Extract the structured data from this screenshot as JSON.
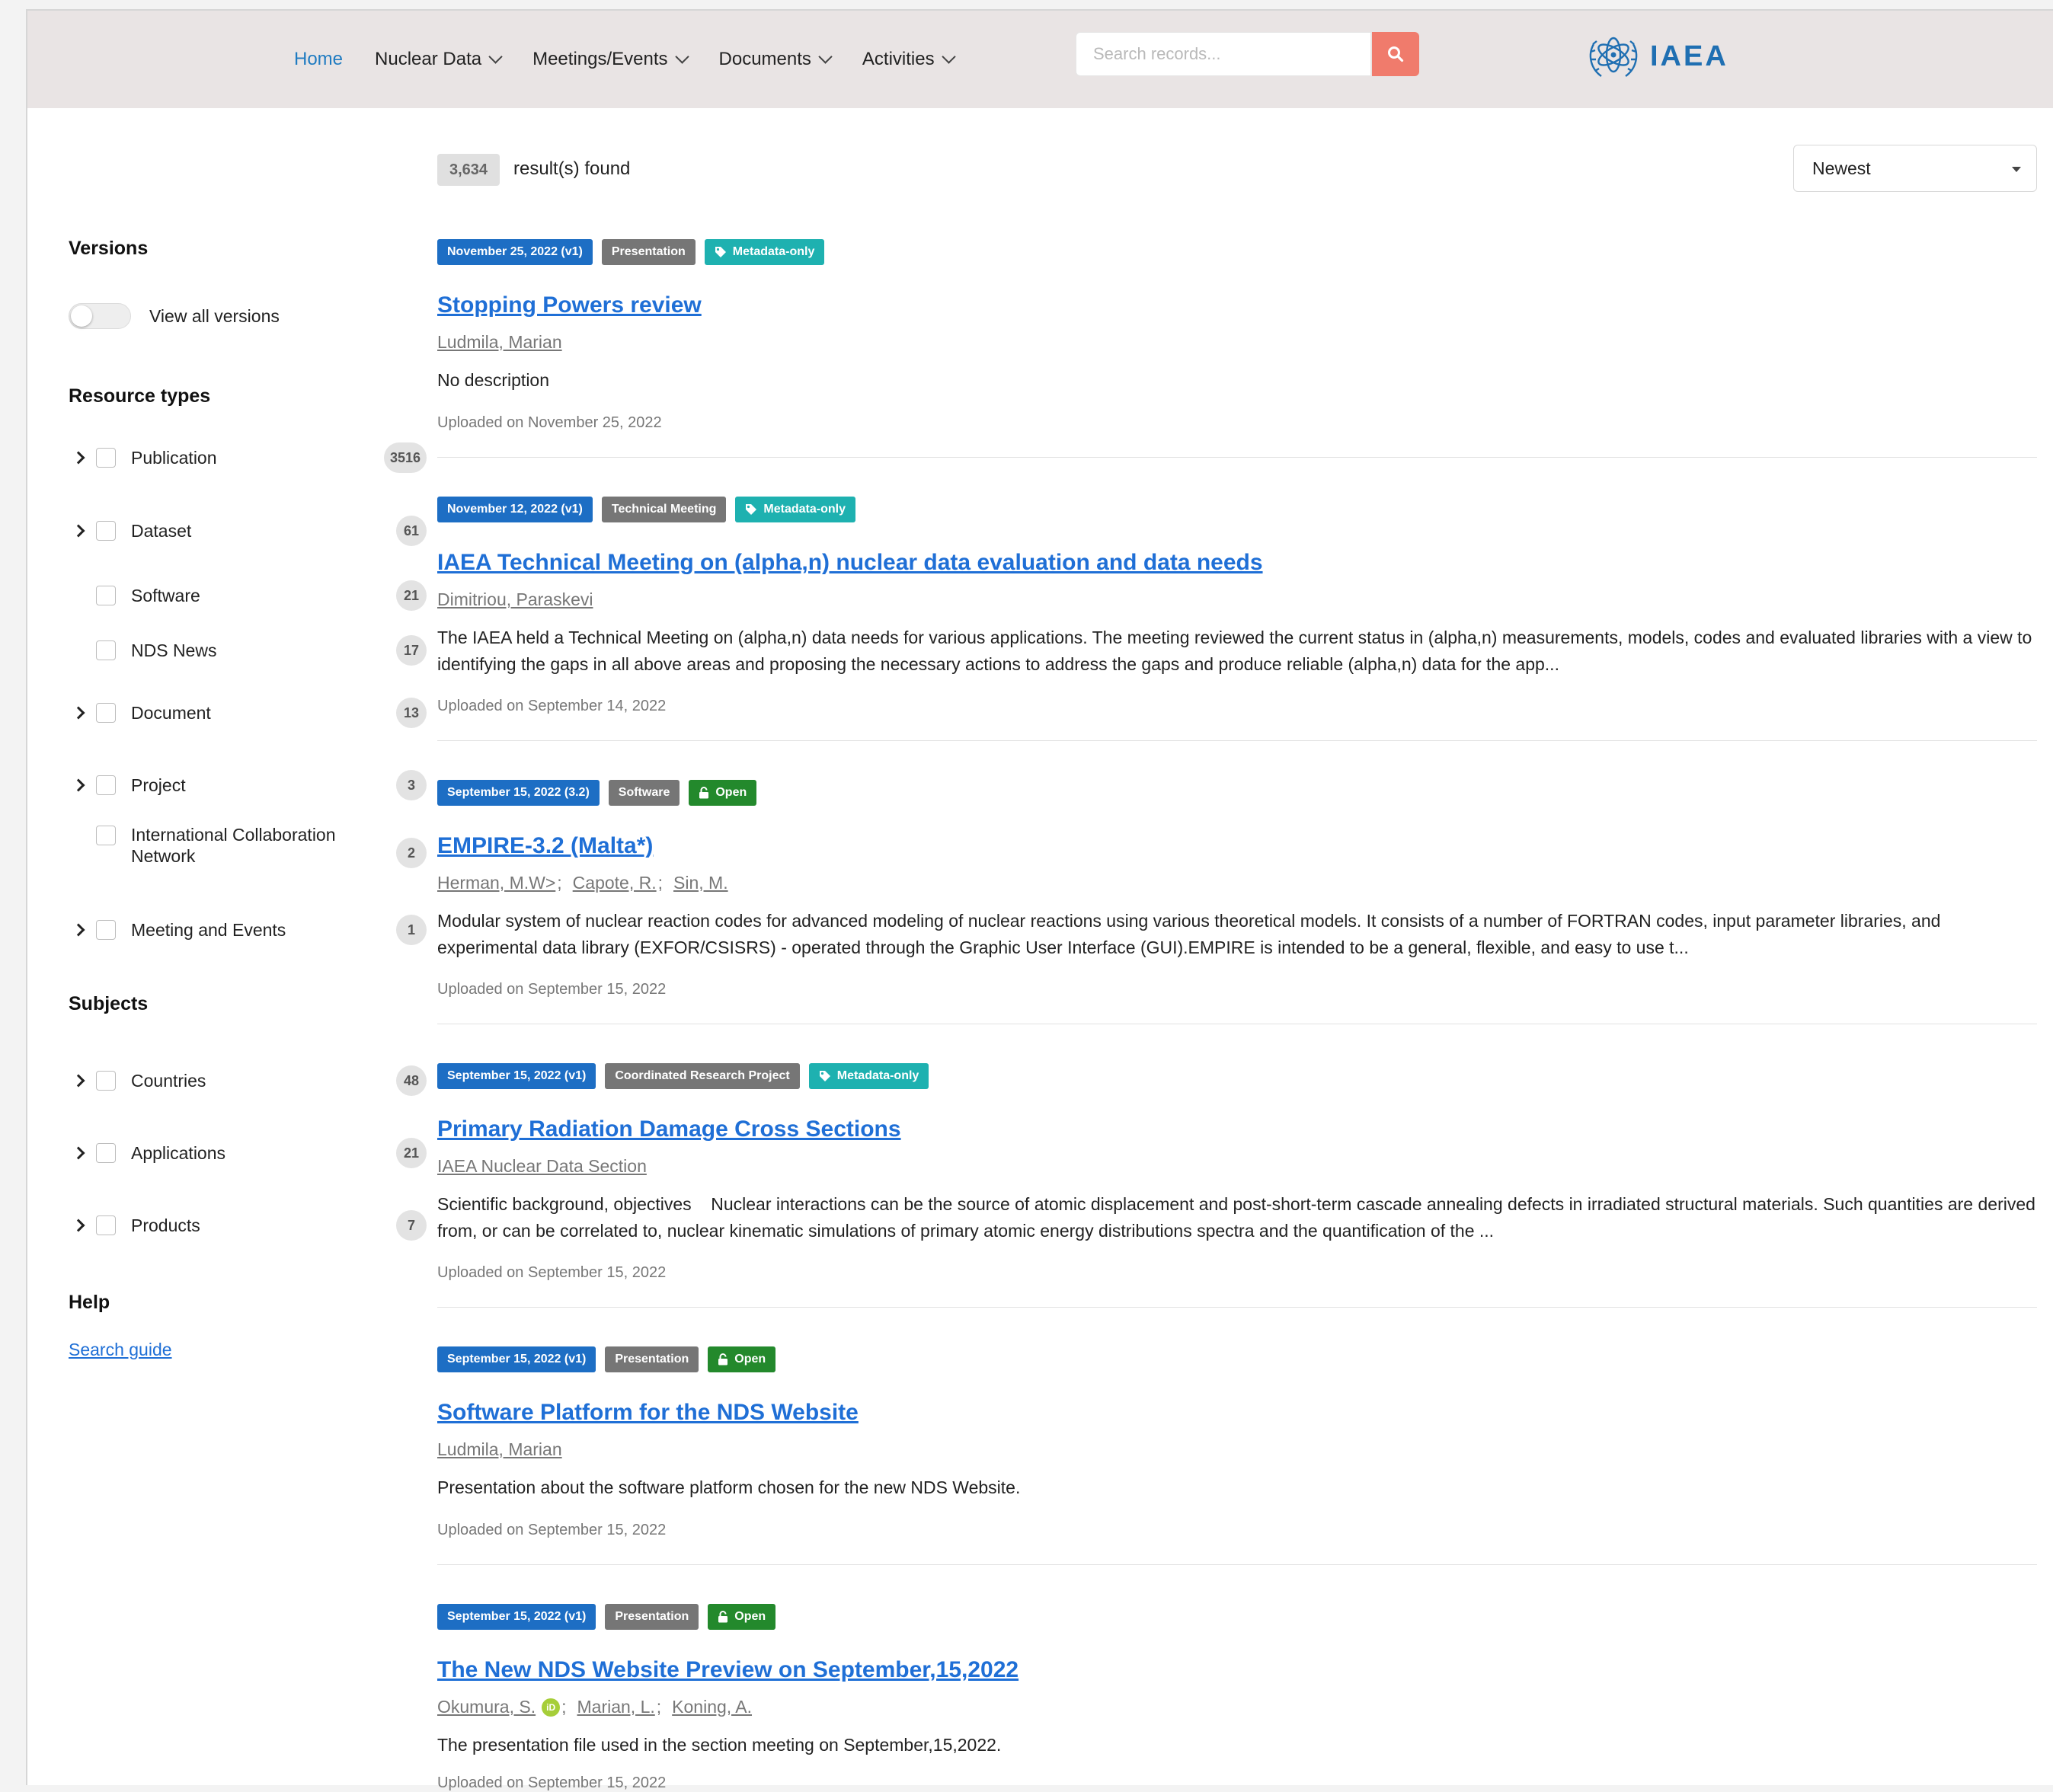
{
  "nav": {
    "items": [
      {
        "label": "Home",
        "active": true,
        "dropdown": false
      },
      {
        "label": "Nuclear Data",
        "active": false,
        "dropdown": true
      },
      {
        "label": "Meetings/Events",
        "active": false,
        "dropdown": true
      },
      {
        "label": "Documents",
        "active": false,
        "dropdown": true
      },
      {
        "label": "Activities",
        "active": false,
        "dropdown": true
      }
    ],
    "search_placeholder": "Search records...",
    "logo_text": "IAEA"
  },
  "results_header": {
    "count": "3,634",
    "count_label": "result(s) found",
    "sort_value": "Newest"
  },
  "sidebar": {
    "versions_heading": "Versions",
    "view_all_versions": "View all versions",
    "resource_types_heading": "Resource types",
    "resource_types": [
      {
        "label": "Publication",
        "count": "3516",
        "expandable": true
      },
      {
        "label": "Dataset",
        "count": "61",
        "expandable": true
      },
      {
        "label": "Software",
        "count": "21",
        "expandable": false
      },
      {
        "label": "NDS News",
        "count": "17",
        "expandable": false
      },
      {
        "label": "Document",
        "count": "13",
        "expandable": true
      },
      {
        "label": "Project",
        "count": "3",
        "expandable": true
      },
      {
        "label": "International Collaboration Network",
        "count": "2",
        "expandable": false
      },
      {
        "label": "Meeting and Events",
        "count": "1",
        "expandable": true
      }
    ],
    "subjects_heading": "Subjects",
    "subjects": [
      {
        "label": "Countries",
        "count": "48",
        "expandable": true
      },
      {
        "label": "Applications",
        "count": "21",
        "expandable": true
      },
      {
        "label": "Products",
        "count": "7",
        "expandable": true
      }
    ],
    "help_heading": "Help",
    "search_guide": "Search guide"
  },
  "results": [
    {
      "date_badge": "November 25, 2022 (v1)",
      "type_badge": "Presentation",
      "access_badge": "Metadata-only",
      "title": "Stopping Powers review",
      "authors": [
        "Ludmila, Marian"
      ],
      "description": "No description",
      "uploaded": "Uploaded on November 25, 2022"
    },
    {
      "date_badge": "November 12, 2022 (v1)",
      "type_badge": "Technical Meeting",
      "access_badge": "Metadata-only",
      "title": "IAEA Technical Meeting on (alpha,n) nuclear data evaluation and data needs",
      "authors": [
        "Dimitriou, Paraskevi"
      ],
      "description": "The IAEA held a Technical Meeting on (alpha,n) data needs for various applications. The meeting reviewed the current status in (alpha,n) measurements, models, codes and evaluated libraries with a view to identifying the gaps in all above areas and proposing the necessary actions to address the gaps and produce reliable (alpha,n) data for the app...",
      "uploaded": "Uploaded on September 14, 2022"
    },
    {
      "date_badge": "September 15, 2022 (3.2)",
      "type_badge": "Software",
      "access_badge": "Open",
      "title": "EMPIRE-3.2 (Malta*)",
      "authors": [
        "Herman, M.W>",
        "Capote, R.",
        "Sin, M."
      ],
      "description": "Modular system of nuclear reaction codes for advanced modeling of nuclear reactions using various theoretical models. It consists of a number of FORTRAN codes, input parameter libraries, and experimental data library (EXFOR/CSISRS) - operated through the Graphic User Interface (GUI).EMPIRE is intended to be a general, flexible, and easy to use t...",
      "uploaded": "Uploaded on September 15, 2022"
    },
    {
      "date_badge": "September 15, 2022 (v1)",
      "type_badge": "Coordinated Research Project",
      "access_badge": "Metadata-only",
      "title": "Primary Radiation Damage Cross Sections",
      "authors": [
        "IAEA Nuclear Data Section"
      ],
      "description": "Scientific background, objectives    Nuclear interactions can be the source of atomic displacement and post-short-term cascade annealing defects in irradiated structural materials. Such quantities are derived from, or can be correlated to, nuclear kinematic simulations of primary atomic energy distributions spectra and the quantification of the ...",
      "uploaded": "Uploaded on September 15, 2022"
    },
    {
      "date_badge": "September 15, 2022 (v1)",
      "type_badge": "Presentation",
      "access_badge": "Open",
      "title": "Software Platform for the NDS Website",
      "authors": [
        "Ludmila, Marian"
      ],
      "description": "Presentation about the software platform chosen for the new NDS Website.",
      "uploaded": "Uploaded on September 15, 2022"
    },
    {
      "date_badge": "September 15, 2022 (v1)",
      "type_badge": "Presentation",
      "access_badge": "Open",
      "title": "The New NDS Website Preview on September,15,2022",
      "authors": [
        "Okumura, S.",
        "Marian, L.",
        "Koning, A."
      ],
      "orcid_on_first_author": "iD",
      "description": "The presentation file used in the section meeting on September,15,2022.",
      "uploaded": "Uploaded on September 15, 2022"
    }
  ],
  "colors": {
    "link": "#1f6fd6",
    "date_badge": "#1d6ec4",
    "type_badge": "#767676",
    "metadata_badge": "#1eb1b0",
    "open_badge": "#23892c",
    "search_button": "#f07b6c",
    "header_bg": "#e9e4e4"
  }
}
